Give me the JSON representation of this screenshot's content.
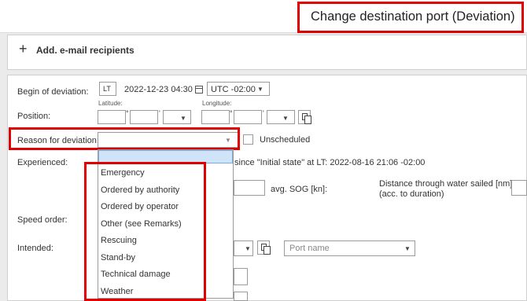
{
  "header": {
    "title": "Change destination port (Deviation)"
  },
  "email": {
    "plus_icon": "+",
    "label": "Add. e-mail recipients"
  },
  "form": {
    "begin_label": "Begin of deviation:",
    "lt_badge": "LT",
    "begin_datetime": "2022-12-23 04:30",
    "utc_offset": "UTC -02:00",
    "position_label": "Position:",
    "latitude_label": "Latitude:",
    "longitude_label": "Longitude:",
    "degree_symbol": "°",
    "minute_symbol": "'",
    "reason_label": "Reason for deviation:",
    "unscheduled_label": "Unscheduled",
    "experienced_label": "Experienced:",
    "experienced_info": "since \"Initial state\" at LT: 2022-08-16 21:06 -02:00",
    "avg_sog_label": "avg. SOG [kn]:",
    "distance_label_line1": "Distance through water sailed [nm]:",
    "distance_label_line2": "(acc. to duration)",
    "speed_order_label": "Speed order:",
    "intended_label": "Intended:",
    "port_placeholder": "Port name"
  },
  "reason_dropdown": {
    "selected": "",
    "options": [
      "Emergency",
      "Ordered by authority",
      "Ordered by operator",
      "Other (see Remarks)",
      "Rescuing",
      "Stand-by",
      "Technical damage",
      "Weather"
    ]
  },
  "colors": {
    "highlight": "#e00000",
    "selected_row": "#cfe3f9",
    "background": "#ebebeb"
  }
}
